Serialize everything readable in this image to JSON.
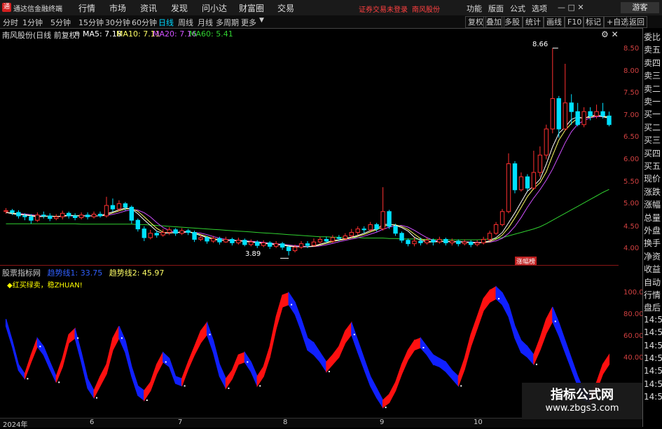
{
  "topbar": {
    "logo": "通",
    "app_name": "通达信金融终端",
    "menu": [
      "行情",
      "市场",
      "资讯",
      "发现",
      "问小达",
      "财富圈",
      "交易"
    ],
    "notice": "证券交易未登录",
    "stock": "南风股份",
    "right_menu": [
      "功能",
      "版面",
      "公式",
      "选项"
    ],
    "guest": "游客"
  },
  "toolbar": {
    "periods": [
      "分时",
      "1分钟",
      "5分钟",
      "15分钟",
      "30分钟",
      "60分钟",
      "日线",
      "周线",
      "月线",
      "多周期",
      "更多"
    ],
    "active": "日线",
    "right": [
      "复权",
      "叠加",
      "多股",
      "统计",
      "画线",
      "F10",
      "标记",
      "+自选",
      "返回"
    ]
  },
  "chart_header": {
    "title": "南风股份(日线 前复权)",
    "ma5": "MA5: 7.18",
    "ma10": "MA10: 7.11",
    "ma20": "MA20: 7.16",
    "ma60": "MA60: 5.41"
  },
  "colors": {
    "up": "#ff3030",
    "down": "#00e0ff",
    "ma5": "#ffffff",
    "ma10": "#ffff66",
    "ma20": "#d050ff",
    "ma60": "#30d030",
    "band_up": "#ff1010",
    "band_down": "#1020ff"
  },
  "right_panel": [
    "委比",
    "卖五",
    "卖四",
    "卖三",
    "卖二",
    "卖一",
    "买一",
    "买二",
    "买三",
    "买四",
    "买五",
    "现价",
    "涨跌",
    "涨幅",
    "总量",
    "外盘",
    "换手",
    "净资",
    "收益",
    "自动",
    "行情",
    "盘后",
    "14:56",
    "14:56",
    "14:56",
    "14:56",
    "14:56",
    "14:56",
    "14:56"
  ],
  "price_axis": [
    "8.50",
    "8.00",
    "7.50",
    "7.00",
    "6.50",
    "6.00",
    "5.50",
    "5.00",
    "4.50",
    "4.00"
  ],
  "indicator": {
    "name": "股票指标网",
    "line1": "趋势线1: 33.75",
    "line2": "趋势线2: 45.97",
    "tag": "◆红买绿卖，稳ZHUAN!",
    "axis": [
      "100.00",
      "80.00",
      "60.00",
      "40.00"
    ]
  },
  "annotations": {
    "high": "8.66",
    "low": "3.89",
    "zm": "涨幅榜"
  },
  "x_axis": [
    "2024年",
    "6",
    "7",
    "8",
    "9",
    "10"
  ],
  "watermark": {
    "line1": "指标公式网",
    "line2": "www.zbgs3.com"
  },
  "chart_data": {
    "type": "candlestick",
    "title": "南风股份(日线 前复权)",
    "ylim": [
      3.8,
      8.8
    ],
    "candles": [
      [
        4.9,
        4.92,
        4.98,
        4.85
      ],
      [
        4.92,
        4.88,
        4.96,
        4.82
      ],
      [
        4.88,
        4.8,
        4.93,
        4.74
      ],
      [
        4.8,
        4.78,
        4.86,
        4.7
      ],
      [
        4.78,
        4.7,
        4.84,
        4.62
      ],
      [
        4.7,
        4.82,
        4.88,
        4.66
      ],
      [
        4.82,
        4.8,
        4.9,
        4.74
      ],
      [
        4.8,
        4.74,
        4.86,
        4.68
      ],
      [
        4.74,
        4.78,
        4.84,
        4.7
      ],
      [
        4.78,
        4.86,
        4.92,
        4.72
      ],
      [
        4.86,
        4.8,
        4.9,
        4.74
      ],
      [
        4.8,
        4.76,
        4.86,
        4.7
      ],
      [
        4.76,
        4.82,
        4.88,
        4.72
      ],
      [
        4.82,
        4.78,
        4.88,
        4.72
      ],
      [
        4.78,
        4.84,
        4.9,
        4.74
      ],
      [
        4.84,
        4.8,
        4.9,
        4.76
      ],
      [
        4.8,
        5.04,
        5.24,
        4.76
      ],
      [
        5.04,
        4.96,
        5.2,
        4.9
      ],
      [
        4.96,
        5.08,
        5.16,
        4.9
      ],
      [
        5.08,
        5.0,
        5.12,
        4.92
      ],
      [
        5.0,
        4.7,
        5.04,
        4.62
      ],
      [
        4.7,
        4.5,
        4.74,
        4.44
      ],
      [
        4.5,
        4.3,
        4.56,
        4.22
      ],
      [
        4.3,
        4.4,
        4.48,
        4.26
      ],
      [
        4.4,
        4.36,
        4.46,
        4.3
      ],
      [
        4.36,
        4.42,
        4.5,
        4.32
      ],
      [
        4.42,
        4.48,
        4.54,
        4.36
      ],
      [
        4.48,
        4.4,
        4.52,
        4.34
      ],
      [
        4.4,
        4.46,
        4.52,
        4.36
      ],
      [
        4.46,
        4.42,
        4.5,
        4.36
      ],
      [
        4.42,
        4.26,
        4.46,
        4.2
      ],
      [
        4.26,
        4.3,
        4.36,
        4.22
      ],
      [
        4.3,
        4.22,
        4.34,
        4.16
      ],
      [
        4.22,
        4.28,
        4.34,
        4.18
      ],
      [
        4.28,
        4.2,
        4.32,
        4.14
      ],
      [
        4.2,
        4.26,
        4.32,
        4.18
      ],
      [
        4.26,
        4.18,
        4.3,
        4.12
      ],
      [
        4.18,
        4.24,
        4.3,
        4.14
      ],
      [
        4.24,
        4.14,
        4.28,
        4.1
      ],
      [
        4.14,
        4.2,
        4.26,
        4.1
      ],
      [
        4.2,
        4.12,
        4.24,
        4.06
      ],
      [
        4.12,
        4.18,
        4.24,
        4.08
      ],
      [
        4.18,
        4.1,
        4.22,
        4.04
      ],
      [
        4.1,
        4.16,
        4.22,
        4.06
      ],
      [
        4.16,
        4.08,
        4.2,
        4.02
      ],
      [
        4.08,
        4.0,
        4.12,
        3.89
      ],
      [
        4.0,
        4.08,
        4.14,
        3.96
      ],
      [
        4.08,
        4.16,
        4.22,
        4.04
      ],
      [
        4.16,
        4.12,
        4.22,
        4.06
      ],
      [
        4.12,
        4.2,
        4.28,
        4.1
      ],
      [
        4.2,
        4.26,
        4.32,
        4.16
      ],
      [
        4.26,
        4.22,
        4.32,
        4.18
      ],
      [
        4.22,
        4.3,
        4.36,
        4.18
      ],
      [
        4.3,
        4.28,
        4.36,
        4.22
      ],
      [
        4.28,
        4.34,
        4.4,
        4.24
      ],
      [
        4.34,
        4.42,
        4.5,
        4.3
      ],
      [
        4.42,
        4.5,
        4.56,
        4.36
      ],
      [
        4.5,
        4.48,
        4.56,
        4.4
      ],
      [
        4.48,
        4.6,
        4.66,
        4.44
      ],
      [
        4.6,
        4.5,
        4.64,
        4.44
      ],
      [
        4.5,
        4.9,
        5.46,
        4.46
      ],
      [
        4.9,
        4.56,
        4.94,
        4.5
      ],
      [
        4.56,
        4.4,
        4.62,
        4.34
      ],
      [
        4.4,
        4.24,
        4.44,
        4.18
      ],
      [
        4.24,
        4.16,
        4.28,
        4.1
      ],
      [
        4.16,
        4.22,
        4.3,
        4.1
      ],
      [
        4.22,
        4.18,
        4.3,
        4.12
      ],
      [
        4.18,
        4.24,
        4.3,
        4.14
      ],
      [
        4.24,
        4.2,
        4.28,
        4.12
      ],
      [
        4.2,
        4.26,
        4.32,
        4.16
      ],
      [
        4.26,
        4.18,
        4.3,
        4.12
      ],
      [
        4.18,
        4.22,
        4.28,
        4.12
      ],
      [
        4.22,
        4.16,
        4.26,
        4.1
      ],
      [
        4.16,
        4.2,
        4.26,
        4.12
      ],
      [
        4.2,
        4.14,
        4.24,
        4.08
      ],
      [
        4.14,
        4.18,
        4.24,
        4.1
      ],
      [
        4.18,
        4.26,
        4.32,
        4.14
      ],
      [
        4.26,
        4.4,
        4.46,
        4.22
      ],
      [
        4.4,
        4.6,
        4.66,
        4.36
      ],
      [
        4.6,
        4.9,
        4.96,
        4.56
      ],
      [
        4.9,
        6.0,
        6.24,
        4.86
      ],
      [
        6.0,
        5.4,
        6.06,
        5.32
      ],
      [
        5.4,
        5.7,
        5.8,
        5.36
      ],
      [
        5.7,
        5.44,
        5.76,
        5.38
      ],
      [
        5.44,
        5.8,
        6.3,
        5.4
      ],
      [
        5.8,
        6.2,
        6.4,
        5.7
      ],
      [
        6.2,
        6.8,
        6.9,
        6.1
      ],
      [
        6.8,
        7.5,
        8.66,
        6.7
      ],
      [
        7.5,
        6.8,
        7.56,
        6.6
      ],
      [
        6.8,
        7.4,
        8.3,
        6.76
      ],
      [
        7.4,
        7.2,
        7.6,
        6.9
      ],
      [
        7.2,
        6.9,
        7.4,
        6.86
      ],
      [
        6.9,
        7.2,
        7.3,
        6.84
      ],
      [
        7.2,
        7.1,
        7.3,
        7.0
      ],
      [
        7.1,
        7.2,
        7.36,
        7.04
      ],
      [
        7.2,
        7.1,
        7.4,
        7.04
      ],
      [
        7.1,
        6.9,
        7.2,
        6.86
      ]
    ],
    "ma5": [
      4.88,
      4.85,
      4.83,
      4.82,
      4.8,
      4.78,
      4.79,
      4.8,
      4.78,
      4.8,
      4.82,
      4.8,
      4.8,
      4.8,
      4.8,
      4.8,
      4.85,
      4.89,
      4.94,
      4.98,
      4.96,
      4.85,
      4.71,
      4.58,
      4.45,
      4.4,
      4.41,
      4.42,
      4.43,
      4.44,
      4.39,
      4.35,
      4.3,
      4.26,
      4.24,
      4.24,
      4.23,
      4.23,
      4.21,
      4.2,
      4.18,
      4.17,
      4.15,
      4.14,
      4.13,
      4.1,
      4.09,
      4.09,
      4.09,
      4.11,
      4.15,
      4.19,
      4.23,
      4.25,
      4.28,
      4.31,
      4.35,
      4.4,
      4.46,
      4.5,
      4.6,
      4.61,
      4.58,
      4.53,
      4.45,
      4.31,
      4.24,
      4.2,
      4.2,
      4.22,
      4.21,
      4.21,
      4.2,
      4.2,
      4.18,
      4.18,
      4.19,
      4.23,
      4.3,
      4.42,
      4.64,
      4.87,
      5.12,
      5.37,
      5.49,
      5.64,
      5.99,
      6.39,
      6.7,
      6.84,
      7.02,
      7.08,
      7.04,
      7.1,
      7.12,
      7.08,
      7.05
    ],
    "ma60": [
      4.62,
      4.62,
      4.62,
      4.62,
      4.62,
      4.62,
      4.62,
      4.62,
      4.62,
      4.62,
      4.62,
      4.62,
      4.61,
      4.61,
      4.61,
      4.61,
      4.61,
      4.61,
      4.61,
      4.61,
      4.61,
      4.6,
      4.6,
      4.59,
      4.58,
      4.57,
      4.56,
      4.55,
      4.54,
      4.53,
      4.52,
      4.51,
      4.5,
      4.49,
      4.48,
      4.47,
      4.46,
      4.45,
      4.44,
      4.43,
      4.42,
      4.41,
      4.4,
      4.39,
      4.38,
      4.37,
      4.36,
      4.35,
      4.34,
      4.33,
      4.32,
      4.32,
      4.31,
      4.31,
      4.3,
      4.3,
      4.3,
      4.29,
      4.29,
      4.29,
      4.29,
      4.28,
      4.28,
      4.27,
      4.27,
      4.27,
      4.26,
      4.26,
      4.26,
      4.25,
      4.25,
      4.25,
      4.25,
      4.25,
      4.25,
      4.25,
      4.26,
      4.27,
      4.28,
      4.3,
      4.34,
      4.38,
      4.42,
      4.46,
      4.5,
      4.55,
      4.62,
      4.7,
      4.78,
      4.86,
      4.94,
      5.02,
      5.1,
      5.18,
      5.26,
      5.34,
      5.41
    ],
    "ind_ylim": [
      0,
      115
    ],
    "ind_top": [
      78,
      60,
      40,
      32,
      48,
      62,
      55,
      42,
      30,
      45,
      65,
      70,
      50,
      28,
      18,
      30,
      40,
      62,
      72,
      60,
      38,
      22,
      18,
      25,
      40,
      50,
      45,
      30,
      28,
      42,
      55,
      68,
      75,
      60,
      40,
      28,
      35,
      48,
      50,
      42,
      30,
      38,
      55,
      80,
      98,
      100,
      92,
      78,
      62,
      58,
      50,
      42,
      48,
      55,
      68,
      75,
      60,
      45,
      30,
      20,
      10,
      15,
      25,
      40,
      52,
      60,
      62,
      55,
      48,
      45,
      42,
      35,
      30,
      45,
      65,
      80,
      95,
      102,
      105,
      100,
      90,
      72,
      60,
      55,
      48,
      62,
      78,
      88,
      75,
      60,
      45,
      30,
      18,
      15,
      25,
      40,
      48
    ],
    "ind_bot": [
      72,
      55,
      35,
      28,
      42,
      55,
      48,
      36,
      25,
      38,
      58,
      62,
      42,
      20,
      12,
      22,
      32,
      52,
      62,
      50,
      30,
      14,
      10,
      18,
      32,
      42,
      38,
      24,
      22,
      36,
      48,
      58,
      65,
      50,
      30,
      20,
      28,
      40,
      42,
      34,
      22,
      30,
      46,
      70,
      88,
      90,
      82,
      68,
      52,
      48,
      42,
      34,
      40,
      46,
      58,
      65,
      50,
      36,
      22,
      12,
      4,
      8,
      18,
      32,
      44,
      52,
      54,
      48,
      40,
      38,
      34,
      28,
      22,
      36,
      55,
      70,
      85,
      92,
      95,
      90,
      80,
      62,
      50,
      46,
      40,
      52,
      66,
      76,
      64,
      50,
      36,
      22,
      10,
      8,
      18,
      32,
      40
    ]
  }
}
